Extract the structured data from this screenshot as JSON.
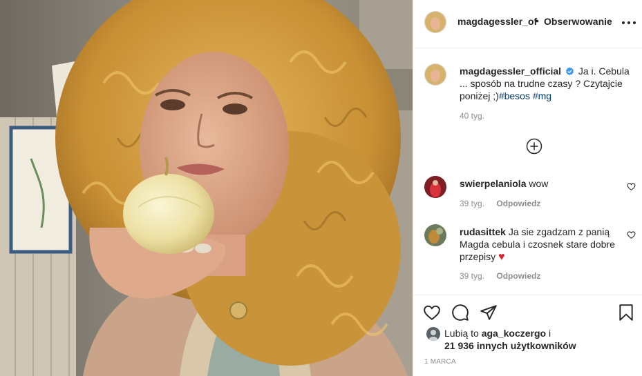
{
  "header": {
    "username": "magdagessler_of",
    "separator": "•",
    "follow_status": "Obserwowanie"
  },
  "caption": {
    "username": "magdagessler_official",
    "verified": true,
    "text": "Ja i. Cebula ... sposób na trudne czasy ? Czytajcie poniżej ;)",
    "hashtags": [
      "#besos",
      "#mg"
    ],
    "time": "40 tyg."
  },
  "comments": [
    {
      "username": "swierpelaniola",
      "text": "wow",
      "time": "39 tyg.",
      "reply_label": "Odpowiedz"
    },
    {
      "username": "rudasittek",
      "text": "Ja sie zgadzam z panią Magda cebula i czosnek stare dobre przepisy",
      "emoji": "♥",
      "time": "39 tyg.",
      "reply_label": "Odpowiedz"
    }
  ],
  "likes": {
    "prefix": "Lubią to",
    "liker": "aga_koczergo",
    "conjunction": "i",
    "others": "21 936 innych użytkowników"
  },
  "post_date": "1 MARCA",
  "colors": {
    "link": "#00376b",
    "secondary_text": "#8e8e8e",
    "verified_blue": "#3897f0",
    "heart_red": "#ed4956",
    "divider": "#efefef"
  }
}
